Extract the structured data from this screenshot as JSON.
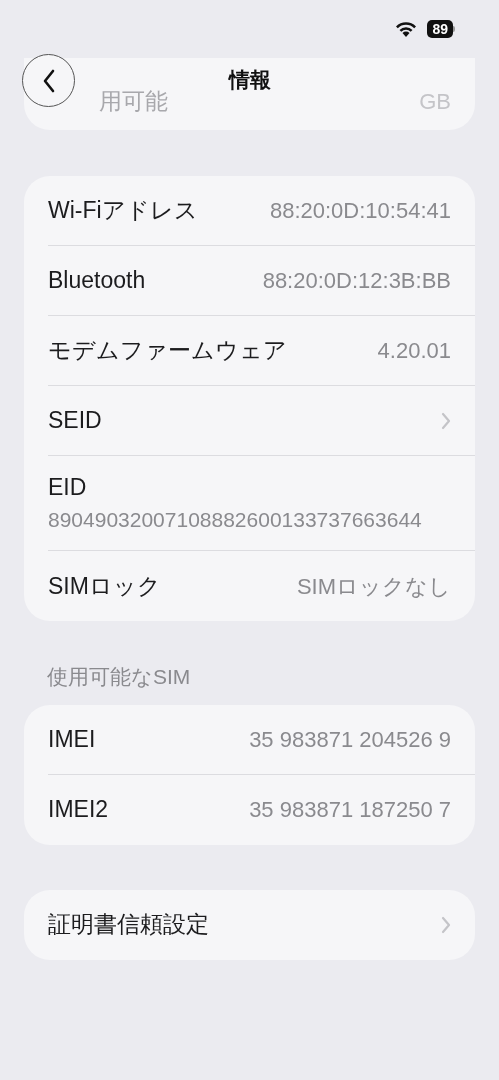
{
  "status_bar": {
    "battery": "89"
  },
  "nav": {
    "title": "情報"
  },
  "top_row": {
    "label": "用可能",
    "value": "GB"
  },
  "groups": [
    {
      "rows": [
        {
          "kind": "value",
          "label": "Wi-Fiアドレス",
          "value": "88:20:0D:10:54:41"
        },
        {
          "kind": "value",
          "label": "Bluetooth",
          "value": "88:20:0D:12:3B:BB"
        },
        {
          "kind": "value",
          "label": "モデムファームウェア",
          "value": "4.20.01"
        },
        {
          "kind": "chevron",
          "label": "SEID"
        },
        {
          "kind": "multiline",
          "label": "EID",
          "value": "89049032007108882600133737663644"
        },
        {
          "kind": "value",
          "label": "SIMロック",
          "value": "SIMロックなし"
        }
      ]
    },
    {
      "header": "使用可能なSIM",
      "rows": [
        {
          "kind": "value",
          "label": "IMEI",
          "value": "35 983871 204526 9"
        },
        {
          "kind": "value",
          "label": "IMEI2",
          "value": "35 983871 187250 7"
        }
      ]
    },
    {
      "rows": [
        {
          "kind": "chevron",
          "label": "証明書信頼設定"
        }
      ]
    }
  ]
}
